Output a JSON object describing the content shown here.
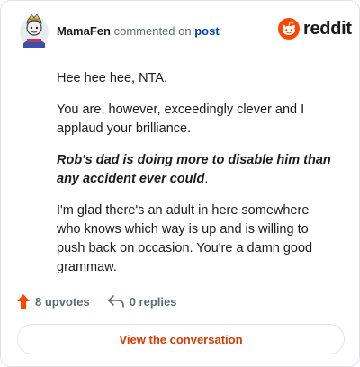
{
  "header": {
    "author": "MamaFen",
    "action": "commented on",
    "target": "post"
  },
  "brand": {
    "name": "reddit",
    "color": "#ff4500"
  },
  "comment": {
    "para1": "Hee hee hee, NTA.",
    "para2": "You are, however, exceedingly clever and I applaud your brilliance.",
    "para3_emphasis": "Rob's dad is doing more to disable him than any accident ever could",
    "para3_tail": ".",
    "para4": "I'm glad there's an adult in here somewhere who knows which way is up and is willing to push back on occasion. You're a damn good grammaw."
  },
  "footer": {
    "upvotes": "8 upvotes",
    "replies": "0 replies",
    "upvote_icon": "upvote-arrow-icon",
    "reply_icon": "reply-arrow-icon"
  },
  "cta": {
    "label": "View the conversation",
    "color": "#d93a00"
  }
}
